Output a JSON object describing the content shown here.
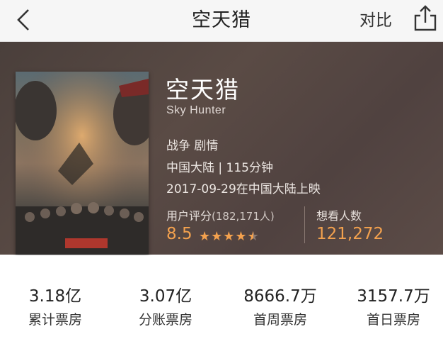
{
  "nav": {
    "title": "空天猎",
    "compare_label": "对比",
    "back_icon": "chevron-left-icon",
    "share_icon": "share-icon"
  },
  "movie": {
    "title": "空天猎",
    "english_title": "Sky Hunter",
    "genres": "战争  剧情",
    "region_duration": "中国大陆  |  115分钟",
    "release": "2017-09-29在中国大陆上映",
    "rating_label": "用户评分",
    "rating_count": "(182,171人)",
    "rating_value": "8.5",
    "rating_stars": 4.5,
    "want_label": "想看人数",
    "want_value": "121,272"
  },
  "colors": {
    "accent": "#f3a14e",
    "hero_bg": "#524440"
  },
  "stats": [
    {
      "value": "3.18亿",
      "label": "累计票房"
    },
    {
      "value": "3.07亿",
      "label": "分账票房"
    },
    {
      "value": "8666.7万",
      "label": "首周票房"
    },
    {
      "value": "3157.7万",
      "label": "首日票房"
    }
  ]
}
